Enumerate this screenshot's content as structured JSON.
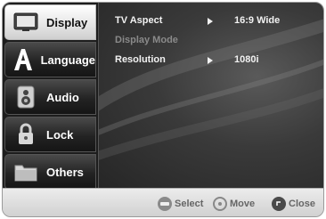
{
  "sidebar": {
    "items": [
      {
        "label": "Display",
        "icon": "display-icon"
      },
      {
        "label": "Language",
        "icon": "language-icon"
      },
      {
        "label": "Audio",
        "icon": "audio-icon"
      },
      {
        "label": "Lock",
        "icon": "lock-icon"
      },
      {
        "label": "Others",
        "icon": "others-icon"
      }
    ],
    "active": "Display"
  },
  "settings": {
    "rows": [
      {
        "name": "TV Aspect",
        "value": "16:9 Wide"
      },
      {
        "name": "Display Mode",
        "value": ""
      },
      {
        "name": "Resolution",
        "value": "1080i"
      }
    ]
  },
  "footer": {
    "select_label": "Select",
    "move_label": "Move",
    "close_label": "Close"
  }
}
